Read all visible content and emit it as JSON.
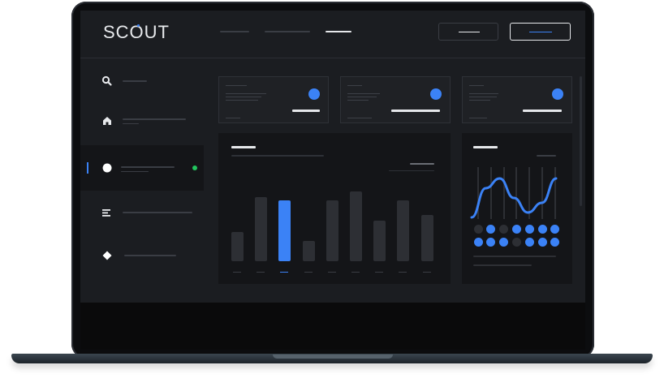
{
  "app": {
    "logo": "SCOUT",
    "accent": "#3b82f6",
    "status_color": "#22c55e",
    "bg": "#1b1d21"
  },
  "sidebar": {
    "items": [
      {
        "icon": "search-icon",
        "glyph": "⚲"
      },
      {
        "icon": "home-icon",
        "glyph": "⌂"
      },
      {
        "icon": "circle-icon",
        "glyph": "●",
        "active": true,
        "status": "online"
      },
      {
        "icon": "list-icon",
        "glyph": "≡"
      },
      {
        "icon": "diamond-icon",
        "glyph": "◆"
      }
    ]
  },
  "chart_data": [
    {
      "type": "bar",
      "values": [
        5,
        11,
        10.5,
        3.5,
        10.5,
        12,
        7,
        10.5,
        8
      ],
      "highlighted_index": 2,
      "ylim": [
        0,
        12
      ]
    },
    {
      "type": "line",
      "values": [
        1,
        4,
        5,
        3,
        1.5,
        2.5,
        5
      ]
    }
  ],
  "dot_matrix": {
    "rows": [
      [
        0,
        1,
        0,
        1,
        1,
        1,
        1
      ],
      [
        1,
        1,
        1,
        0,
        1,
        1,
        1
      ]
    ]
  }
}
